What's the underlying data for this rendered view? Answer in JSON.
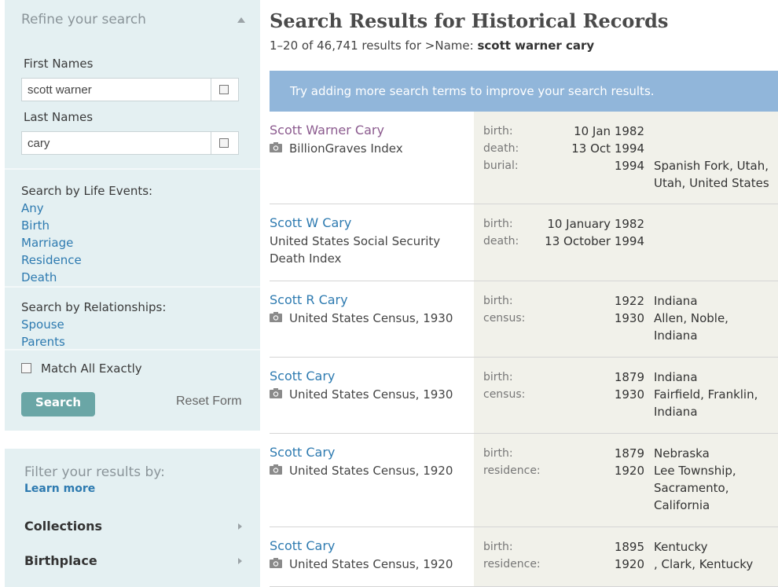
{
  "sidebar": {
    "refine_title": "Refine your search",
    "first_names_label": "First Names",
    "first_names_value": "scott warner",
    "last_names_label": "Last Names",
    "last_names_value": "cary",
    "life_events_label": "Search by Life Events:",
    "life_events": [
      "Any",
      "Birth",
      "Marriage",
      "Residence",
      "Death"
    ],
    "relationships_label": "Search by Relationships:",
    "relationships": [
      "Spouse",
      "Parents"
    ],
    "match_exactly_label": "Match All Exactly",
    "search_button": "Search",
    "reset_link": "Reset Form",
    "filter_title": "Filter your results by:",
    "learn_more": "Learn more",
    "filters": [
      "Collections",
      "Birthplace"
    ]
  },
  "main": {
    "title": "Search Results for Historical Records",
    "summary_prefix": "1–20 of 46,741 results for >Name:",
    "summary_query": "scott warner cary",
    "tip": "Try adding more search terms to improve your search results.",
    "results": [
      {
        "name": "Scott Warner Cary",
        "collection": "BillionGraves Index",
        "has_image": true,
        "visited": true,
        "events": [
          {
            "label": "birth:",
            "date": "10 Jan 1982",
            "place": ""
          },
          {
            "label": "death:",
            "date": "13 Oct 1994",
            "place": ""
          },
          {
            "label": "burial:",
            "date": "1994",
            "place": "Spanish Fork, Utah, Utah, United States"
          }
        ]
      },
      {
        "name": "Scott W Cary",
        "collection": "United States Social Security Death Index",
        "has_image": false,
        "visited": false,
        "events": [
          {
            "label": "birth:",
            "date": "10 January 1982",
            "place": ""
          },
          {
            "label": "death:",
            "date": "13 October 1994",
            "place": ""
          }
        ]
      },
      {
        "name": "Scott R Cary",
        "collection": "United States Census, 1930",
        "has_image": true,
        "visited": false,
        "events": [
          {
            "label": "birth:",
            "date": "1922",
            "place": "Indiana"
          },
          {
            "label": "census:",
            "date": "1930",
            "place": "Allen, Noble, Indiana"
          }
        ]
      },
      {
        "name": "Scott Cary",
        "collection": "United States Census, 1930",
        "has_image": true,
        "visited": false,
        "events": [
          {
            "label": "birth:",
            "date": "1879",
            "place": "Indiana"
          },
          {
            "label": "census:",
            "date": "1930",
            "place": "Fairfield, Franklin, Indiana"
          }
        ]
      },
      {
        "name": "Scott Cary",
        "collection": "United States Census, 1920",
        "has_image": true,
        "visited": false,
        "events": [
          {
            "label": "birth:",
            "date": "1879",
            "place": "Nebraska"
          },
          {
            "label": "residence:",
            "date": "1920",
            "place": "Lee Township, Sacramento, California"
          }
        ]
      },
      {
        "name": "Scott Cary",
        "collection": "United States Census, 1920",
        "has_image": true,
        "visited": false,
        "events": [
          {
            "label": "birth:",
            "date": "1895",
            "place": "Kentucky"
          },
          {
            "label": "residence:",
            "date": "1920",
            "place": ", Clark, Kentucky"
          }
        ]
      }
    ]
  }
}
